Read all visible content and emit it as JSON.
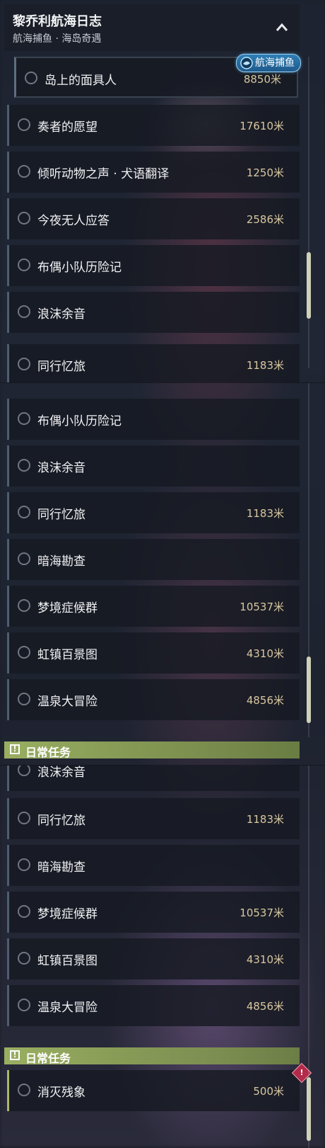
{
  "panel": {
    "title": "黎乔利航海日志",
    "subtitle": "航海捕鱼 · 海岛奇遇",
    "tag": "航海捕鱼"
  },
  "daily_header": "日常任务",
  "segment_a": [
    {
      "title": "岛上的面具人",
      "distance": "8850米"
    },
    {
      "title": "奏者的愿望",
      "distance": "17610米"
    },
    {
      "title": "倾听动物之声 · 犬语翻译",
      "distance": "1250米"
    },
    {
      "title": "今夜无人应答",
      "distance": "2586米"
    },
    {
      "title": "布偶小队历险记",
      "distance": ""
    },
    {
      "title": "浪沫余音",
      "distance": ""
    },
    {
      "title": "同行忆旅",
      "distance": "1183米"
    }
  ],
  "segment_b": [
    {
      "title": "布偶小队历险记",
      "distance": ""
    },
    {
      "title": "浪沫余音",
      "distance": ""
    },
    {
      "title": "同行忆旅",
      "distance": "1183米"
    },
    {
      "title": "暗海勘查",
      "distance": ""
    },
    {
      "title": "梦境症候群",
      "distance": "10537米"
    },
    {
      "title": "虹镇百景图",
      "distance": "4310米"
    },
    {
      "title": "温泉大冒险",
      "distance": "4856米"
    }
  ],
  "segment_c": [
    {
      "title": "浪沫余音",
      "distance": ""
    },
    {
      "title": "同行忆旅",
      "distance": "1183米"
    },
    {
      "title": "暗海勘查",
      "distance": ""
    },
    {
      "title": "梦境症候群",
      "distance": "10537米"
    },
    {
      "title": "虹镇百景图",
      "distance": "4310米"
    },
    {
      "title": "温泉大冒险",
      "distance": "4856米"
    }
  ],
  "daily_tasks": [
    {
      "title": "消灭残象",
      "distance": "500米"
    }
  ],
  "icons": {
    "collapse": "chevron-up-icon",
    "tag": "fishing-icon",
    "daily": "exclamation-icon",
    "alert": "alert-diamond-icon"
  }
}
